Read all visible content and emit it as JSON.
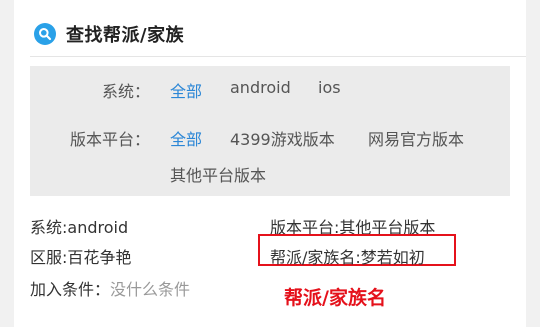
{
  "header": {
    "title": "查找帮派/家族",
    "icon": "search-icon"
  },
  "filters": {
    "system": {
      "label": "系统：",
      "options": [
        "全部",
        "android",
        "ios"
      ],
      "selected": "全部"
    },
    "platform": {
      "label": "版本平台：",
      "options": [
        "全部",
        "4399游戏版本",
        "网易官方版本",
        "其他平台版本"
      ],
      "selected": "全部"
    }
  },
  "details": {
    "system": "系统:android",
    "platform": "版本平台:其他平台版本",
    "server": "区服:百花争艳",
    "guild": "帮派/家族名:梦若如初",
    "join_label": "加入条件：",
    "join_value": "没什么条件"
  },
  "annotation": "帮派/家族名",
  "colors": {
    "accent": "#2a86d6",
    "highlight": "#e5111b",
    "icon_bg": "#2aa1e8"
  }
}
